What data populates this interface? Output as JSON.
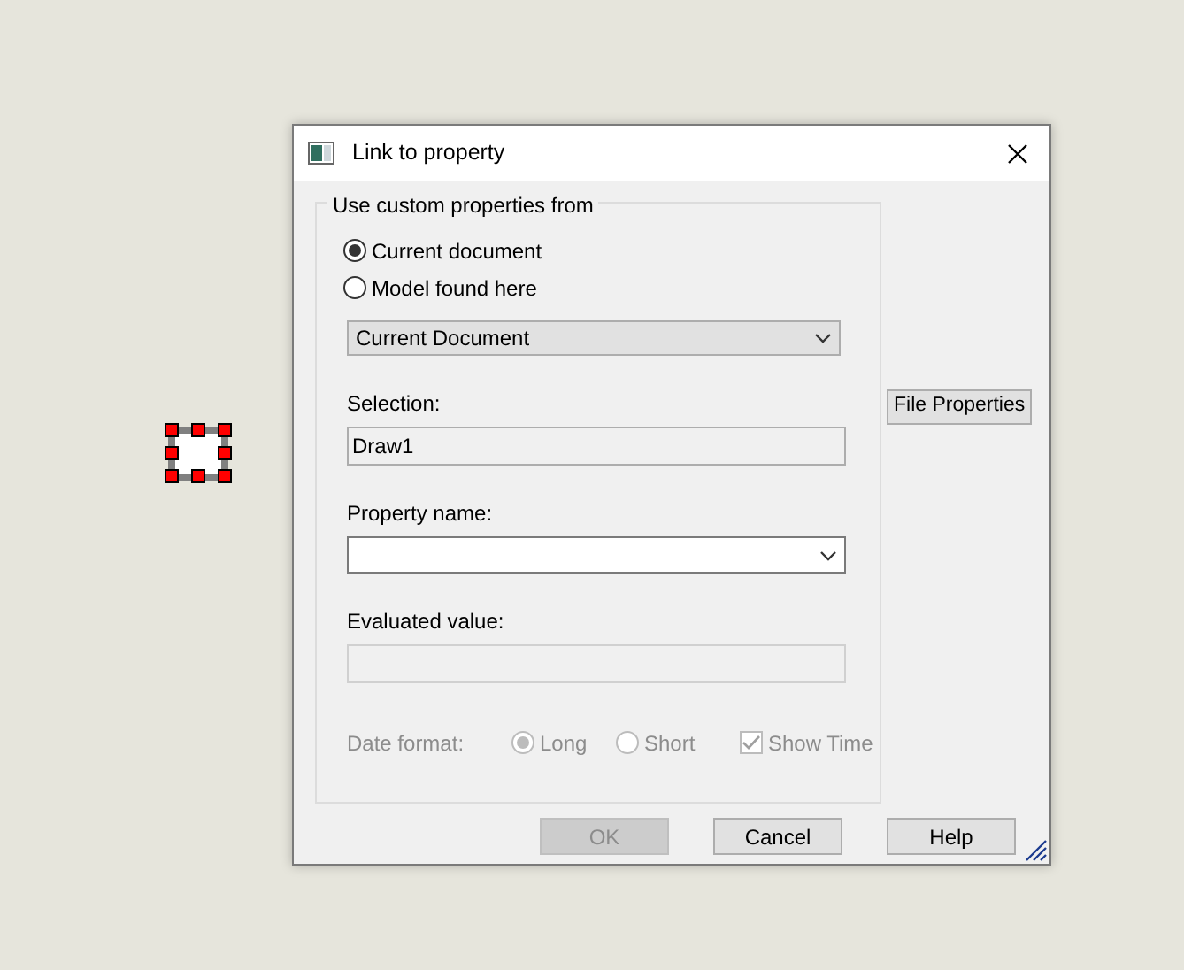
{
  "dialog": {
    "title": "Link to property",
    "group": {
      "legend": "Use custom properties from",
      "source_options": [
        {
          "label": "Current document",
          "selected": true
        },
        {
          "label": "Model found here",
          "selected": false
        }
      ],
      "model_dropdown": {
        "value": "Current Document"
      },
      "selection": {
        "label": "Selection:",
        "value": "Draw1"
      },
      "property_name": {
        "label": "Property name:"
      },
      "evaluated_value": {
        "label": "Evaluated value:",
        "disabled": true
      },
      "date_format": {
        "label": "Date format:",
        "disabled": true,
        "options": [
          {
            "label": "Long",
            "selected": true
          },
          {
            "label": "Short",
            "selected": false
          }
        ],
        "show_time": {
          "label": "Show Time",
          "checked": true
        }
      }
    },
    "file_properties_button": "File Properties",
    "buttons": [
      {
        "label": "OK",
        "disabled": true
      },
      {
        "label": "Cancel",
        "disabled": false
      },
      {
        "label": "Help",
        "disabled": false
      }
    ]
  }
}
